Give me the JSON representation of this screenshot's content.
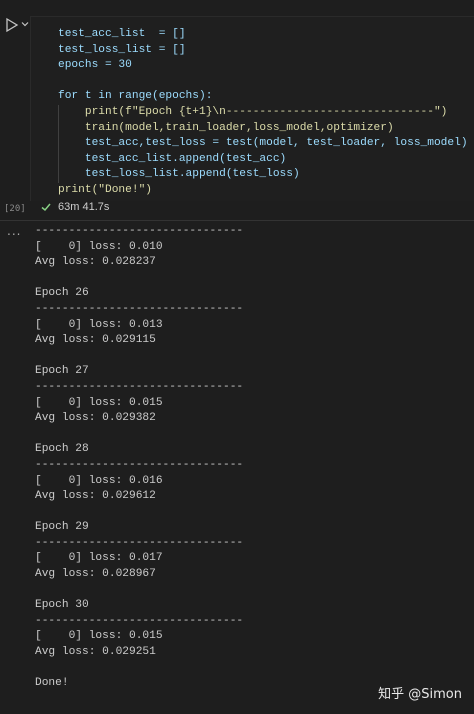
{
  "cell": {
    "execution_count": "[20]",
    "status_time": "63m 41.7s",
    "code_lines": [
      "test_acc_list  = []",
      "test_loss_list = []",
      "epochs = 30",
      "",
      "for t in range(epochs):",
      "    print(f\"Epoch {t+1}\\n-------------------------------\")",
      "    train(model,train_loader,loss_model,optimizer)",
      "    test_acc,test_loss = test(model, test_loader, loss_model)",
      "    test_acc_list.append(test_acc)",
      "    test_loss_list.append(test_loss)",
      "print(\"Done!\")"
    ]
  },
  "output": {
    "menu_label": "...",
    "lines": [
      "-------------------------------",
      "[    0] loss: 0.010",
      "Avg loss: 0.028237",
      "",
      "Epoch 26",
      "-------------------------------",
      "[    0] loss: 0.013",
      "Avg loss: 0.029115",
      "",
      "Epoch 27",
      "-------------------------------",
      "[    0] loss: 0.015",
      "Avg loss: 0.029382",
      "",
      "Epoch 28",
      "-------------------------------",
      "[    0] loss: 0.016",
      "Avg loss: 0.029612",
      "",
      "Epoch 29",
      "-------------------------------",
      "[    0] loss: 0.017",
      "Avg loss: 0.028967",
      "",
      "Epoch 30",
      "-------------------------------",
      "[    0] loss: 0.015",
      "Avg loss: 0.029251",
      "",
      "Done!"
    ]
  },
  "watermark": "知乎 @Simon",
  "colors": {
    "background": "#1e1e1e",
    "keyword": "#569cd6",
    "function": "#dcdcaa",
    "string": "#ce9178",
    "number": "#b5cea8",
    "success_check": "#89d185"
  },
  "icons": [
    "run-icon",
    "chevron-down-icon",
    "check-icon",
    "more-icon"
  ]
}
